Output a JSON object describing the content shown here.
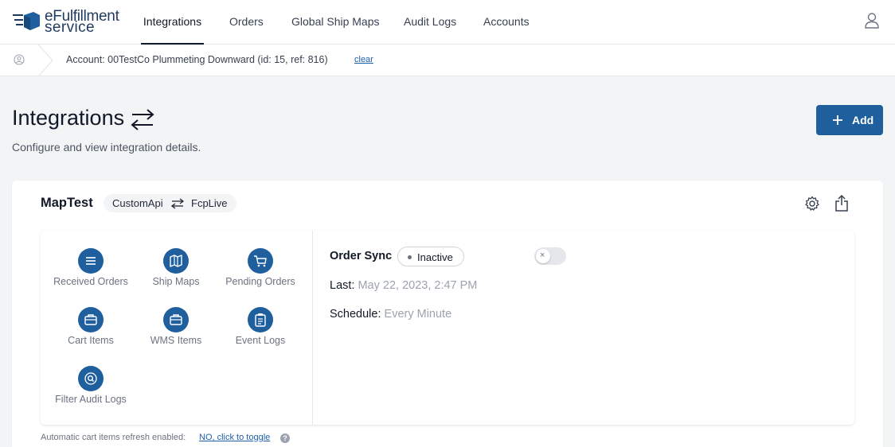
{
  "logo": {
    "line1": "eFulfillment",
    "line2": "service"
  },
  "nav": {
    "items": [
      "Integrations",
      "Orders",
      "Global Ship Maps",
      "Audit Logs",
      "Accounts"
    ],
    "active": "Integrations"
  },
  "account_bar": {
    "text": "Account: 00TestCo Plummeting Downward (id: 15, ref: 816)",
    "clear_label": "clear"
  },
  "header": {
    "title": "Integrations",
    "subtitle": "Configure and view integration details.",
    "add_label": "Add"
  },
  "integration": {
    "name": "MapTest",
    "source": "CustomApi",
    "destination": "FcpLive",
    "tiles": [
      {
        "label": "Received Orders",
        "icon": "list-icon"
      },
      {
        "label": "Ship Maps",
        "icon": "map-icon"
      },
      {
        "label": "Pending Orders",
        "icon": "cart-icon"
      },
      {
        "label": "Cart Items",
        "icon": "briefcase-icon"
      },
      {
        "label": "WMS Items",
        "icon": "briefcase-icon"
      },
      {
        "label": "Event Logs",
        "icon": "clipboard-icon"
      },
      {
        "label": "Filter Audit Logs",
        "icon": "search-icon"
      }
    ],
    "order_sync": {
      "title": "Order Sync",
      "status": "Inactive",
      "toggle_symbol": "×",
      "last_label": "Last:",
      "last_value": "May 22, 2023, 2:47 PM",
      "schedule_label": "Schedule:",
      "schedule_value": "Every Minute"
    }
  },
  "footer": {
    "text": "Automatic cart items refresh enabled:",
    "link": "NO, click to toggle",
    "help": "?"
  },
  "colors": {
    "brand": "#1f5f9e",
    "background": "#f3f4f6"
  }
}
